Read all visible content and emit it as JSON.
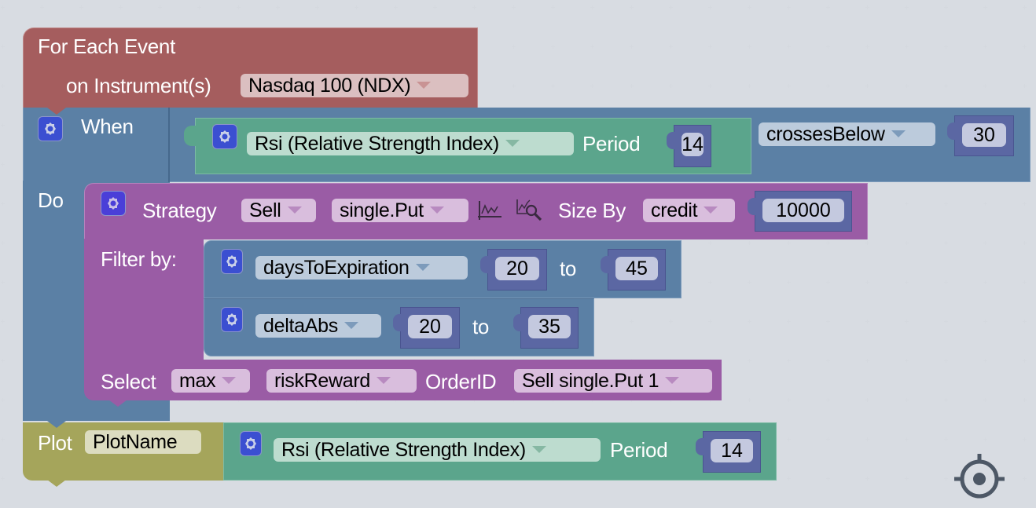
{
  "event_block": {
    "title": "For Each Event",
    "instrument_label": "on Instrument(s)",
    "instrument_value": "Nasdaq 100 (NDX)"
  },
  "when_block": {
    "when_label": "When",
    "do_label": "Do",
    "indicator": {
      "name": "Rsi (Relative Strength Index)",
      "period_label": "Period",
      "period_value": "14"
    },
    "operator": "crossesBelow",
    "threshold": "30"
  },
  "strategy_block": {
    "label": "Strategy",
    "side": "Sell",
    "type": "single.Put",
    "chart_icon": "line-chart-icon",
    "analyze_icon": "chart-search-icon",
    "size_by_label": "Size By",
    "size_by": "credit",
    "size_value": "10000",
    "filter_label": "Filter by:",
    "filters": [
      {
        "field": "daysToExpiration",
        "from": "20",
        "to_label": "to",
        "to": "45"
      },
      {
        "field": "deltaAbs",
        "from": "20",
        "to_label": "to",
        "to": "35"
      }
    ],
    "select_label": "Select",
    "select_agg": "max",
    "select_metric": "riskReward",
    "order_id_label": "OrderID",
    "order_id": "Sell single.Put 1"
  },
  "plot_block": {
    "label": "Plot",
    "plot_name": "PlotName",
    "indicator": {
      "name": "Rsi (Relative Strength Index)",
      "period_label": "Period",
      "period_value": "14"
    }
  },
  "workspace": {
    "recenter_icon": "crosshair-icon"
  },
  "colors": {
    "event": "#a55d5e",
    "logic": "#5b80a5",
    "indicator": "#5ba58c",
    "strategy": "#9a5ca5",
    "number": "#5b67a3",
    "plot": "#a5a55b",
    "background": "#222b37"
  }
}
